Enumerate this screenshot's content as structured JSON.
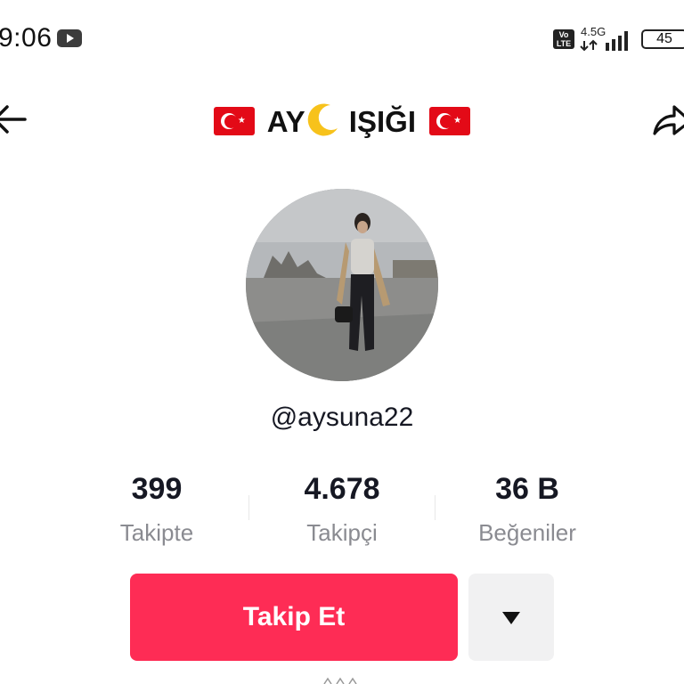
{
  "status_bar": {
    "time": "9:06",
    "volte_label": "Vo LTE",
    "network": "4.5G",
    "battery": "45",
    "icons": [
      "youtube-notification-icon",
      "volte-icon",
      "signal-icon",
      "battery-icon"
    ]
  },
  "header": {
    "title_text_1": "AY",
    "title_text_2": "IŞIĞI",
    "icons": [
      "back-arrow-icon",
      "turkey-flag-icon",
      "crescent-moon-icon",
      "share-icon"
    ]
  },
  "profile": {
    "username": "@aysuna22"
  },
  "stats": [
    {
      "value": "399",
      "label": "Takipte"
    },
    {
      "value": "4.678",
      "label": "Takipçi"
    },
    {
      "value": "36 B",
      "label": "Beğeniler"
    }
  ],
  "actions": {
    "follow_label": "Takip Et"
  },
  "colors": {
    "accent": "#fe2c55",
    "secondary_button": "#f1f1f2",
    "label_gray": "#8a8b91"
  }
}
